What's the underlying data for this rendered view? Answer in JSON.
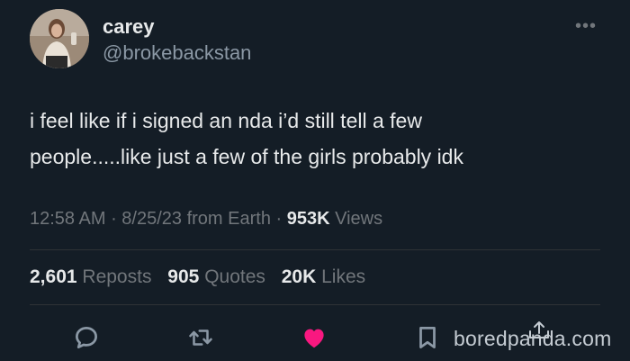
{
  "user": {
    "display_name": "carey",
    "handle": "@brokebackstan"
  },
  "tweet": {
    "text": "i feel like if i signed an nda i’d still tell a few\npeople.....like just a few of the girls probably idk",
    "time": "12:58 AM",
    "date": "8/25/23",
    "source": "from Earth",
    "views_count": "953K",
    "views_label": "Views"
  },
  "stats": {
    "reposts_count": "2,601",
    "reposts_label": "Reposts",
    "quotes_count": "905",
    "quotes_label": "Quotes",
    "likes_count": "20K",
    "likes_label": "Likes"
  },
  "more_label": "•••",
  "watermark": "boredpanda.com",
  "icons": [
    "more-icon",
    "reply-icon",
    "repost-icon",
    "like-icon",
    "bookmark-icon"
  ],
  "colors": {
    "background": "#141d26",
    "text": "#e7e9ea",
    "secondary": "#71767b",
    "like": "#f91880"
  }
}
